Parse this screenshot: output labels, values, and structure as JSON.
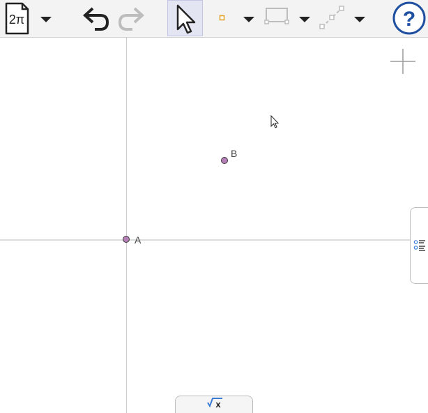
{
  "toolbar": {
    "menu_label": "2π",
    "tools": [
      {
        "name": "menu-button"
      },
      {
        "name": "undo-button"
      },
      {
        "name": "redo-button",
        "enabled": false
      },
      {
        "name": "move-tool",
        "selected": true
      },
      {
        "name": "point-tool"
      },
      {
        "name": "segment-tool",
        "enabled": false
      },
      {
        "name": "line-tool",
        "enabled": false
      }
    ],
    "help_label": "?"
  },
  "graphics": {
    "points": [
      {
        "id": "A",
        "label": "A",
        "color": "#b57eb6"
      },
      {
        "id": "B",
        "label": "B",
        "color": "#b57eb6"
      }
    ]
  },
  "input_bar": {
    "label": "√x"
  },
  "colors": {
    "selected_tool_bg": "#e3e5f3",
    "help_accent": "#1e4fa0",
    "disabled": "#bdbdbd"
  }
}
